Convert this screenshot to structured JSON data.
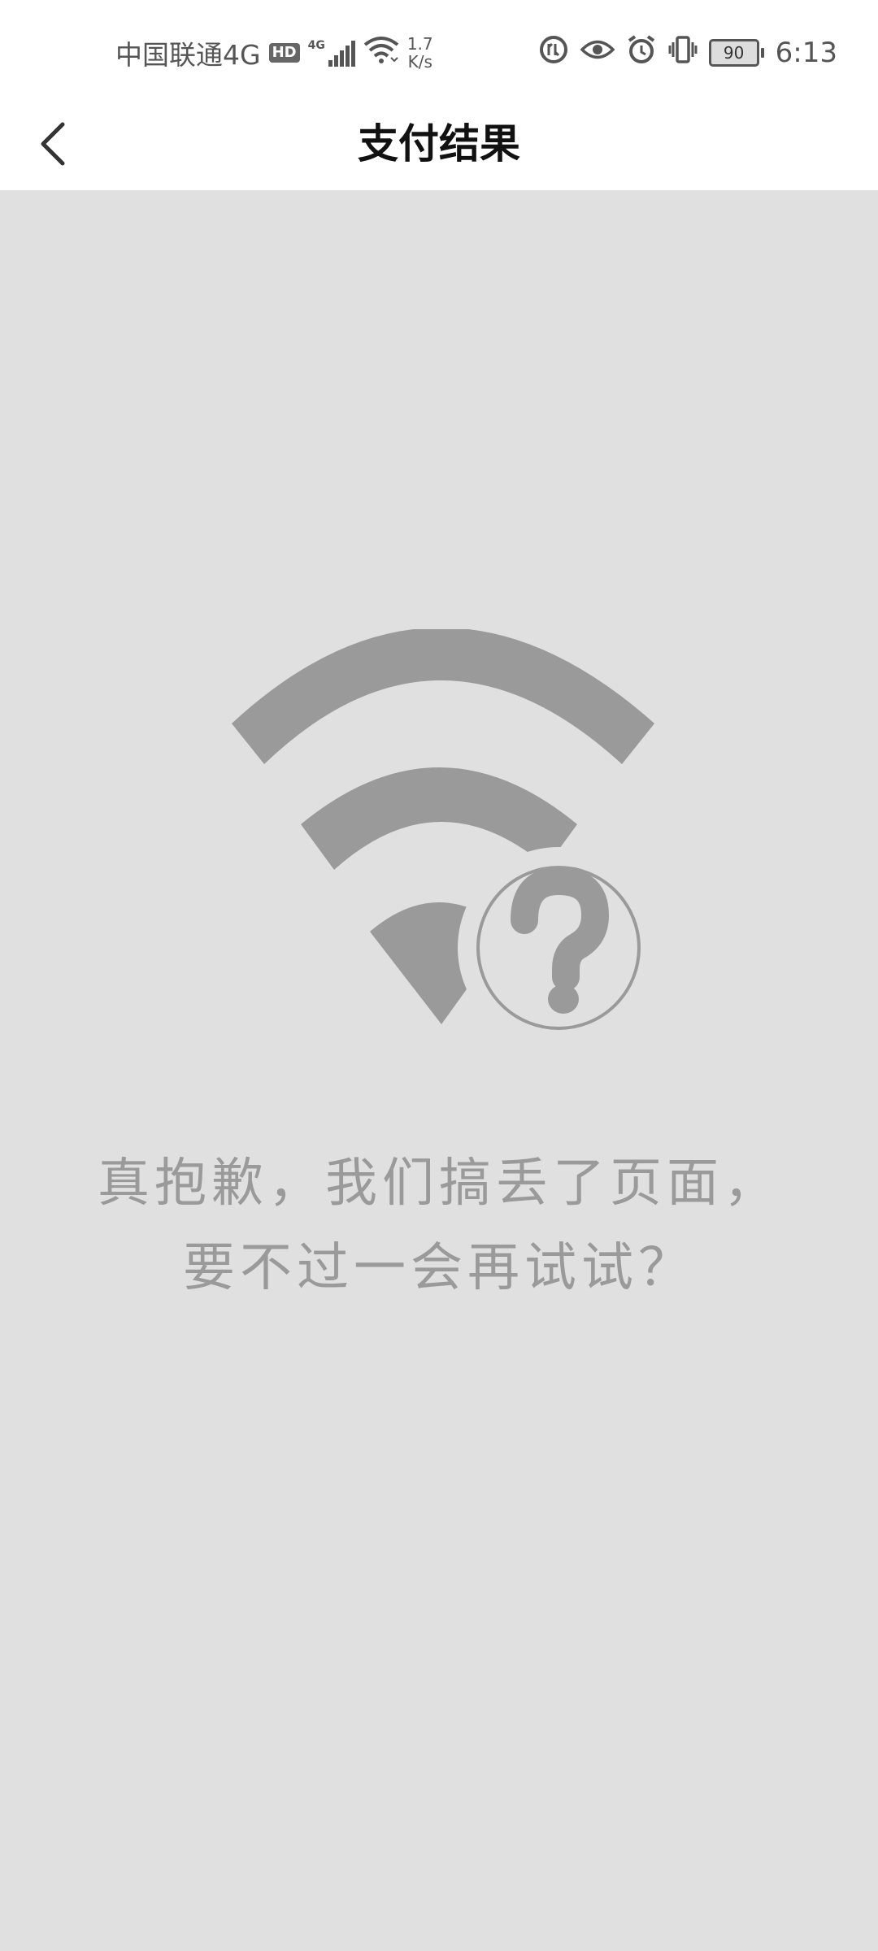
{
  "status_bar": {
    "carrier": "中国联通4G",
    "hd_badge": "HD",
    "network_type": "4G",
    "speed_value": "1.7",
    "speed_unit": "K/s",
    "battery_level": "90",
    "time": "6:13",
    "icons": [
      "hd-icon",
      "signal-icon",
      "wifi-icon",
      "data-saver-icon",
      "eye-comfort-icon",
      "alarm-icon",
      "vibrate-icon",
      "battery-icon"
    ]
  },
  "header": {
    "title": "支付结果",
    "back_icon": "back-chevron-icon"
  },
  "error": {
    "illustration": "wifi-question-icon",
    "line1": "真抱歉，我们搞丢了页面，",
    "line2": "要不过一会再试试？"
  },
  "colors": {
    "content_bg": "#e0e0e0",
    "illustration": "#9a9a9a",
    "message_text": "#9a9a9a",
    "title_text": "#111111"
  }
}
